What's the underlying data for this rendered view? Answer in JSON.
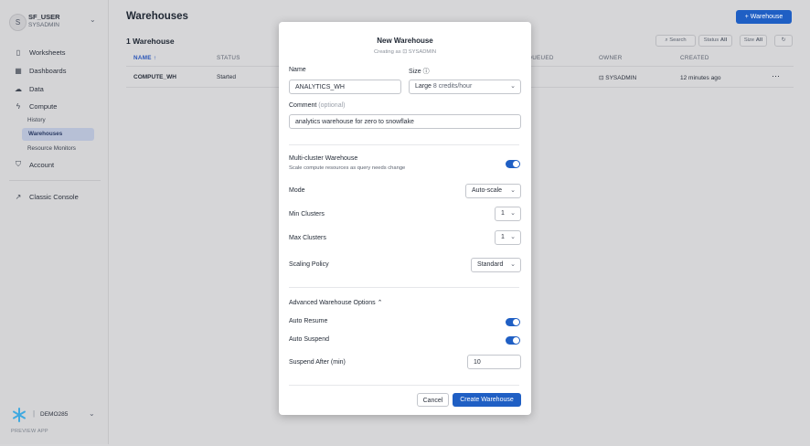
{
  "sidebar": {
    "user_name": "SF_USER",
    "user_role": "SYSADMIN",
    "avatar_initial": "S",
    "items": [
      {
        "label": "Worksheets",
        "icon": "file-icon"
      },
      {
        "label": "Dashboards",
        "icon": "grid-icon"
      },
      {
        "label": "Data",
        "icon": "cloud-icon"
      },
      {
        "label": "Compute",
        "icon": "bolt-icon"
      }
    ],
    "compute_sub": [
      "History",
      "Warehouses",
      "Resource Monitors"
    ],
    "account_label": "Account",
    "classic_console_label": "Classic Console",
    "org_name": "DEMO285",
    "preview_label": "PREVIEW APP"
  },
  "main": {
    "title": "Warehouses",
    "new_button_label": "Warehouse",
    "count_label": "1 Warehouse",
    "search_label": "Search",
    "status_filter": {
      "label": "Status",
      "value": "All"
    },
    "size_filter": {
      "label": "Size",
      "value": "All"
    },
    "columns": [
      "NAME",
      "STATUS",
      "QUEUED",
      "OWNER",
      "CREATED"
    ],
    "rows": [
      {
        "name": "COMPUTE_WH",
        "status": "Started",
        "owner": "SYSADMIN",
        "created": "12 minutes ago"
      }
    ]
  },
  "modal": {
    "title": "New Warehouse",
    "subtitle_prefix": "Creating as",
    "subtitle_role": "SYSADMIN",
    "name_label": "Name",
    "name_value": "ANALYTICS_WH",
    "size_label": "Size",
    "size_value": "Large",
    "size_credits": "8 credits/hour",
    "comment_label": "Comment",
    "comment_optional": "(optional)",
    "comment_value": "analytics warehouse for zero to snowflake",
    "multi_cluster_label": "Multi-cluster Warehouse",
    "multi_cluster_desc": "Scale compute resources as query needs change",
    "mode_label": "Mode",
    "mode_value": "Auto-scale",
    "min_clusters_label": "Min Clusters",
    "min_clusters_value": "1",
    "max_clusters_label": "Max Clusters",
    "max_clusters_value": "1",
    "scaling_policy_label": "Scaling Policy",
    "scaling_policy_value": "Standard",
    "advanced_label": "Advanced Warehouse Options",
    "auto_resume_label": "Auto Resume",
    "auto_suspend_label": "Auto Suspend",
    "suspend_after_label": "Suspend After (min)",
    "suspend_after_value": "10",
    "cancel_label": "Cancel",
    "create_label": "Create Warehouse"
  },
  "colors": {
    "accent": "#1f5fc4",
    "overlay": "#d6d6d8"
  }
}
